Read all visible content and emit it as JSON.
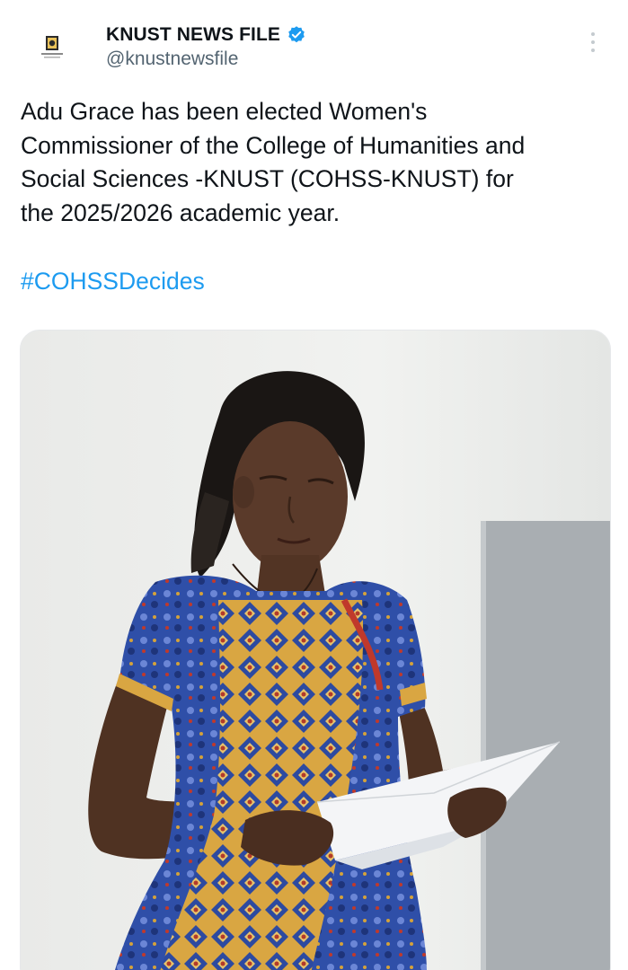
{
  "author": {
    "display_name": "KNUST NEWS FILE",
    "handle": "@knustnewsfile",
    "verified": true,
    "avatar_icon": "knust-news-file-logo-icon"
  },
  "tweet": {
    "text_lines": [
      "Adu Grace has been elected Women's",
      "Commissioner of the College of Humanities and",
      "Social Sciences -KNUST (COHSS-KNUST) for",
      "the 2025/2026 academic year."
    ],
    "hashtag": "#COHSSDecides"
  },
  "media": {
    "alt": ""
  },
  "colors": {
    "text": "#0f1419",
    "secondary": "#536471",
    "link": "#1d9bf0",
    "verified": "#1d9bf0"
  },
  "icons": {
    "verified": "verified-badge-icon",
    "more": "more-options-icon"
  }
}
